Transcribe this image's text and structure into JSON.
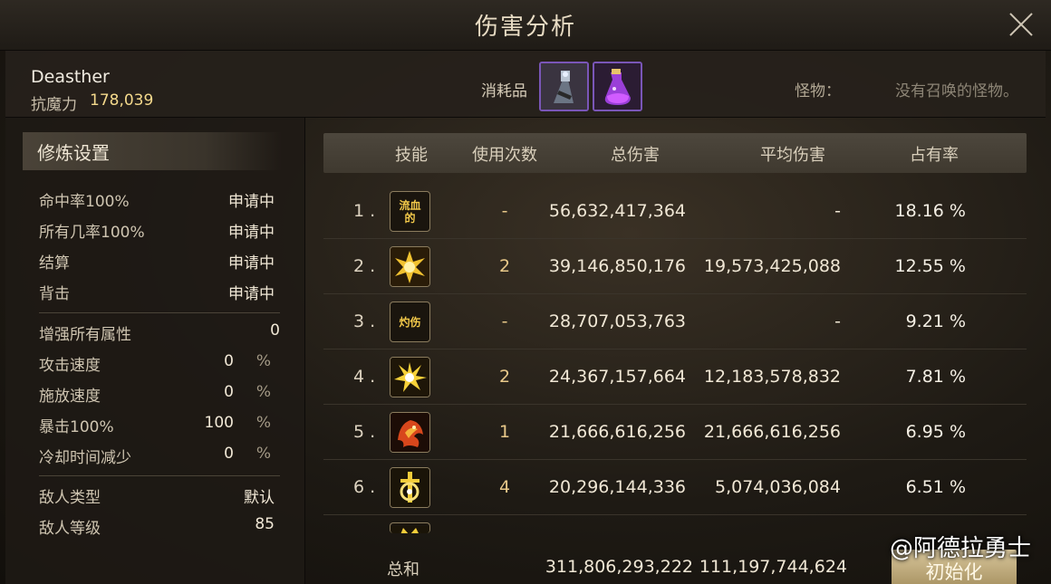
{
  "window": {
    "title": "伤害分析"
  },
  "character": {
    "name": "Deasther",
    "resist_label": "抗魔力",
    "resist_value": "178,039"
  },
  "consumables": {
    "label": "消耗品",
    "items": [
      "potion-flask-icon",
      "purple-potion-icon"
    ]
  },
  "monster": {
    "label": "怪物：",
    "value": "没有召唤的怪物。"
  },
  "settings": {
    "title": "修炼设置",
    "group1": [
      {
        "label": "命中率100%",
        "value": "申请中"
      },
      {
        "label": "所有几率100%",
        "value": "申请中"
      },
      {
        "label": "结算",
        "value": "申请中"
      },
      {
        "label": "背击",
        "value": "申请中"
      }
    ],
    "enhance": {
      "label": "增强所有属性",
      "value": "0"
    },
    "group2": [
      {
        "label": "攻击速度",
        "value": "0",
        "unit": "%"
      },
      {
        "label": "施放速度",
        "value": "0",
        "unit": "%"
      },
      {
        "label": "暴击100%",
        "value": "100",
        "unit": "%"
      },
      {
        "label": "冷却时间减少",
        "value": "0",
        "unit": "%"
      }
    ],
    "group3": [
      {
        "label": "敌人类型",
        "value": "默认"
      },
      {
        "label": "敌人等级",
        "value": "85"
      }
    ]
  },
  "table": {
    "headers": {
      "skill": "技能",
      "uses": "使用次数",
      "total": "总伤害",
      "avg": "平均伤害",
      "share": "占有率"
    },
    "rows": [
      {
        "rank": "1 .",
        "skill_text": "流血\n的",
        "uses": "-",
        "total": "56,632,417,364",
        "avg": "-",
        "share": "18.16 %"
      },
      {
        "rank": "2 .",
        "skill_text": "",
        "icon": "burst-skill-icon",
        "uses": "2",
        "total": "39,146,850,176",
        "avg": "19,573,425,088",
        "share": "12.55 %"
      },
      {
        "rank": "3 .",
        "skill_text": "灼伤",
        "uses": "-",
        "total": "28,707,053,763",
        "avg": "-",
        "share": "9.21 %"
      },
      {
        "rank": "4 .",
        "skill_text": "",
        "icon": "explosion-skill-icon",
        "uses": "2",
        "total": "24,367,157,664",
        "avg": "12,183,578,832",
        "share": "7.81 %"
      },
      {
        "rank": "5 .",
        "skill_text": "",
        "icon": "fire-beast-skill-icon",
        "uses": "1",
        "total": "21,666,616,256",
        "avg": "21,666,616,256",
        "share": "6.95 %"
      },
      {
        "rank": "6 .",
        "skill_text": "",
        "icon": "sword-rune-skill-icon",
        "uses": "4",
        "total": "20,296,144,336",
        "avg": "5,074,036,084",
        "share": "6.51 %"
      }
    ],
    "total": {
      "label": "总和",
      "sum": "311,806,293,222",
      "avg": "111,197,744,624"
    },
    "reset_label": "初始化"
  },
  "watermark": "@阿德拉勇士",
  "colors": {
    "accent_gold": "#f4d98c",
    "item_border": "#7a56b8",
    "button": "#c8b586"
  }
}
